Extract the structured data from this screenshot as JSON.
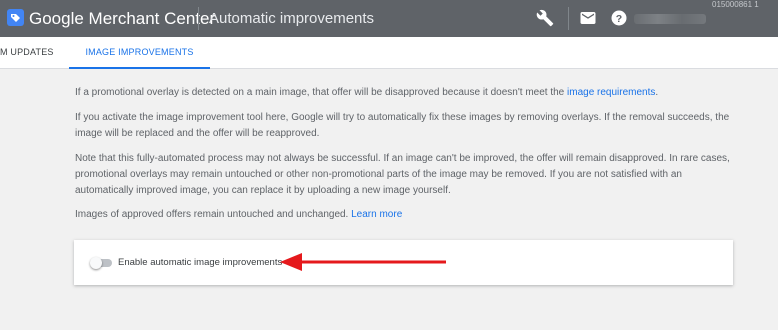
{
  "appbar": {
    "brand": "Google Merchant Center",
    "page_title": "Automatic improvements",
    "account_id": "015000861 1",
    "icons": [
      "tag-icon",
      "wrench-icon",
      "mail-icon",
      "help-icon"
    ]
  },
  "tabs": [
    {
      "label": "M UPDATES",
      "selected": false
    },
    {
      "label": "IMAGE IMPROVEMENTS",
      "selected": true
    }
  ],
  "content": {
    "p1_text": "If a promotional overlay is detected on a main image, that offer will be disapproved because it doesn't meet the ",
    "p1_link": "image requirements",
    "p1_end": ".",
    "p2": "If you activate the image improvement tool here, Google will try to automatically fix these images by removing overlays. If the removal succeeds, the image will be replaced and the offer will be reapproved.",
    "p3": "Note that this fully-automated process may not always be successful. If an image can't be improved, the offer will remain disapproved. In rare cases, promotional overlays may remain untouched or other non-promotional parts of the image may be removed. If you are not satisfied with an automatically improved image, you can replace it by uploading a new image yourself.",
    "p4_text": "Images of approved offers remain untouched and unchanged. ",
    "p4_link": "Learn more"
  },
  "card": {
    "toggle_label": "Enable automatic image improvements",
    "toggle_on": false
  },
  "colors": {
    "appbar": "#5f6368",
    "accent": "#1a73e8",
    "annotation_arrow": "#e5191c"
  }
}
